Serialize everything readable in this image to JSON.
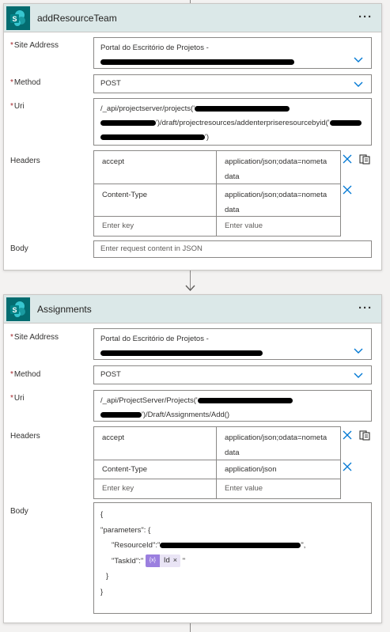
{
  "colors": {
    "header_bg": "#dbe8e8",
    "sharepoint_icon": "#036c70",
    "required": "#a4262c",
    "accent": "#0078d4",
    "token": "#9b7fdf"
  },
  "cards": [
    {
      "title": "addResourceTeam",
      "more_label": "···",
      "icon": "sharepoint-icon",
      "site_label": "Site Address",
      "site_value": "Portal do Escritório de Projetos -",
      "method_label": "Method",
      "method_value": "POST",
      "uri_label": "Uri",
      "uri_line1": "/_api/projectserver/projects('",
      "uri_line2": "')/draft/projectresources/addenterpriseresourcebyid('",
      "uri_line3": "')",
      "headers_label": "Headers",
      "headers": [
        {
          "key": "accept",
          "value_line1": "application/json;odata=nometa",
          "value_line2": "data"
        },
        {
          "key": "Content-Type",
          "value_line1": "application/json;odata=nometa",
          "value_line2": "data"
        }
      ],
      "key_placeholder": "Enter key",
      "value_placeholder": "Enter value",
      "body_label": "Body",
      "body_placeholder": "Enter request content in JSON"
    },
    {
      "title": "Assignments",
      "more_label": "···",
      "icon": "sharepoint-icon",
      "site_label": "Site Address",
      "site_value": "Portal do Escritório de Projetos -",
      "method_label": "Method",
      "method_value": "POST",
      "uri_label": "Uri",
      "uri_line1": "/_api/ProjectServer/Projects('",
      "uri_line2": "')/Draft/Assignments/Add()",
      "headers_label": "Headers",
      "headers": [
        {
          "key": "accept",
          "value_line1": "application/json;odata=nometa",
          "value_line2": "data"
        },
        {
          "key": "Content-Type",
          "value_line1": "application/json",
          "value_line2": ""
        }
      ],
      "key_placeholder": "Enter key",
      "value_placeholder": "Enter value",
      "body_label": "Body",
      "body_lines": [
        "{",
        "\"parameters\": {",
        "\"ResourceId\":\"",
        "\"TaskId\":\"",
        "}",
        "}"
      ],
      "body_resource_suffix": "\",",
      "body_task_suffix": "\"",
      "token_label": "Id",
      "token_close": "×",
      "token_icon_text": "{x}"
    }
  ]
}
